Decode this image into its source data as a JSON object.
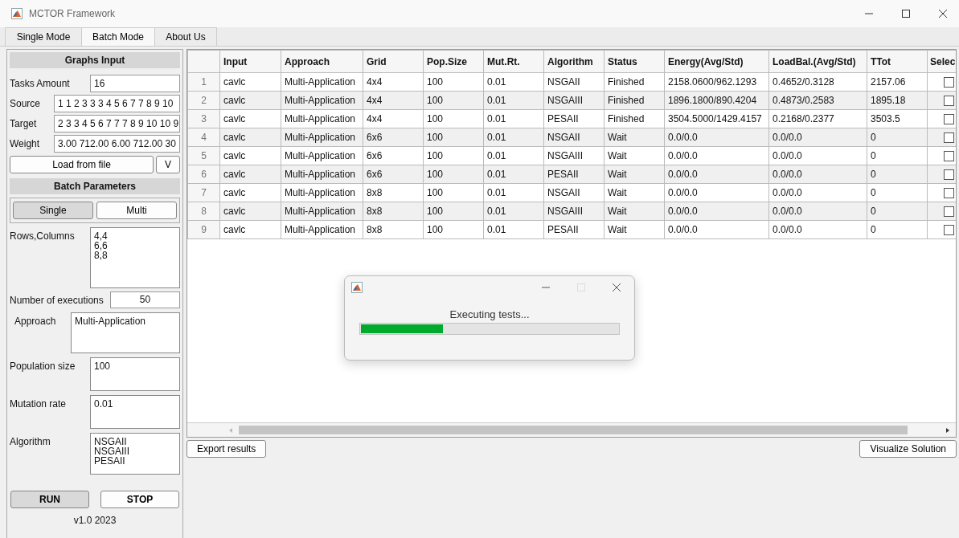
{
  "window": {
    "title": "MCTOR Framework"
  },
  "tabs": [
    {
      "label": "Single Mode",
      "selected": false
    },
    {
      "label": "Batch Mode",
      "selected": true
    },
    {
      "label": "About Us",
      "selected": false
    }
  ],
  "graphs_input": {
    "title": "Graphs Input",
    "fields": [
      {
        "label": "Tasks Amount",
        "value": "16"
      },
      {
        "label": "Source",
        "value": "1 1 2 3 3 3 4 5 6 7 7 8 9 10"
      },
      {
        "label": "Target",
        "value": "2 3 3 4 5 6 7 7 7 8 9 10 10 9"
      },
      {
        "label": "Weight",
        "value": "3.00 712.00 6.00 712.00 30"
      }
    ],
    "load_button": "Load from file",
    "v_button": "V"
  },
  "batch_parameters": {
    "title": "Batch Parameters",
    "modes": [
      {
        "label": "Single",
        "selected": true
      },
      {
        "label": "Multi",
        "selected": false
      }
    ],
    "rows_columns": {
      "label": "Rows,Columns",
      "lines": [
        "4,4",
        "6,6",
        "8,8"
      ]
    },
    "executions": {
      "label": "Number of executions",
      "value": "50"
    },
    "approach": {
      "label": "Approach",
      "lines": [
        "Multi-Application"
      ]
    },
    "population": {
      "label": "Population size",
      "lines": [
        "100"
      ]
    },
    "mutation": {
      "label": "Mutation rate",
      "lines": [
        "0.01"
      ]
    },
    "algorithm": {
      "label": "Algorithm",
      "lines": [
        "NSGAII",
        "NSGAIII",
        "PESAII"
      ]
    }
  },
  "actions": [
    {
      "label": "RUN",
      "pressed": true
    },
    {
      "label": "STOP",
      "pressed": false
    }
  ],
  "version": "v1.0 2023",
  "table": {
    "columns": [
      "Input",
      "Approach",
      "Grid",
      "Pop.Size",
      "Mut.Rt.",
      "Algorithm",
      "Status",
      "Energy(Avg/Std)",
      "LoadBal.(Avg/Std)",
      "TTot",
      "Selec"
    ],
    "rows": [
      {
        "index": "1",
        "cells": [
          "cavlc",
          "Multi-Application",
          "4x4",
          "100",
          "0.01",
          "NSGAII",
          "Finished",
          "2158.0600/962.1293",
          "0.4652/0.3128",
          "2157.06"
        ],
        "checked": false
      },
      {
        "index": "2",
        "cells": [
          "cavlc",
          "Multi-Application",
          "4x4",
          "100",
          "0.01",
          "NSGAIII",
          "Finished",
          "1896.1800/890.4204",
          "0.4873/0.2583",
          "1895.18"
        ],
        "checked": false
      },
      {
        "index": "3",
        "cells": [
          "cavlc",
          "Multi-Application",
          "4x4",
          "100",
          "0.01",
          "PESAII",
          "Finished",
          "3504.5000/1429.4157",
          "0.2168/0.2377",
          "3503.5"
        ],
        "checked": false
      },
      {
        "index": "4",
        "cells": [
          "cavlc",
          "Multi-Application",
          "6x6",
          "100",
          "0.01",
          "NSGAII",
          "Wait",
          "0.0/0.0",
          "0.0/0.0",
          "0"
        ],
        "checked": false
      },
      {
        "index": "5",
        "cells": [
          "cavlc",
          "Multi-Application",
          "6x6",
          "100",
          "0.01",
          "NSGAIII",
          "Wait",
          "0.0/0.0",
          "0.0/0.0",
          "0"
        ],
        "checked": false
      },
      {
        "index": "6",
        "cells": [
          "cavlc",
          "Multi-Application",
          "6x6",
          "100",
          "0.01",
          "PESAII",
          "Wait",
          "0.0/0.0",
          "0.0/0.0",
          "0"
        ],
        "checked": false
      },
      {
        "index": "7",
        "cells": [
          "cavlc",
          "Multi-Application",
          "8x8",
          "100",
          "0.01",
          "NSGAII",
          "Wait",
          "0.0/0.0",
          "0.0/0.0",
          "0"
        ],
        "checked": false
      },
      {
        "index": "8",
        "cells": [
          "cavlc",
          "Multi-Application",
          "8x8",
          "100",
          "0.01",
          "NSGAIII",
          "Wait",
          "0.0/0.0",
          "0.0/0.0",
          "0"
        ],
        "checked": false
      },
      {
        "index": "9",
        "cells": [
          "cavlc",
          "Multi-Application",
          "8x8",
          "100",
          "0.01",
          "PESAII",
          "Wait",
          "0.0/0.0",
          "0.0/0.0",
          "0"
        ],
        "checked": false
      }
    ]
  },
  "bottom_buttons": [
    "Export results",
    "Visualize Solution"
  ],
  "progress_dialog": {
    "message": "Executing tests...",
    "level": 0.32
  }
}
